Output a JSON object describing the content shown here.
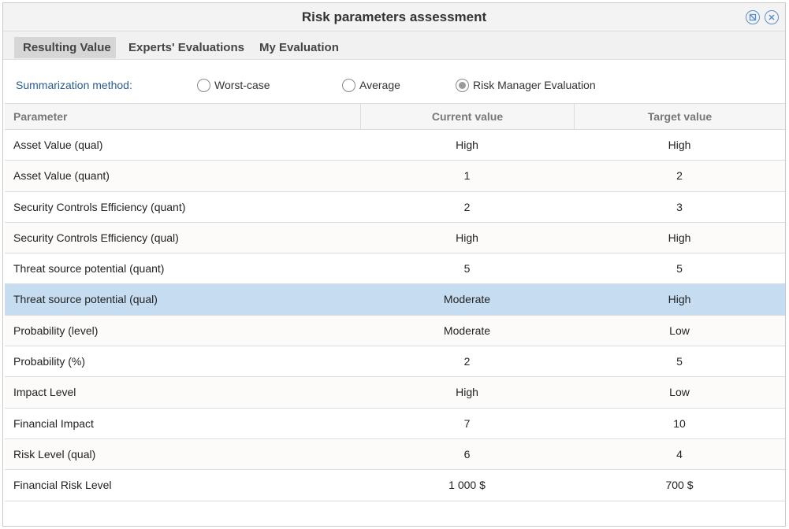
{
  "window": {
    "title": "Risk parameters assessment",
    "accent_color": "#5b8fc9"
  },
  "tabs": [
    {
      "label": "Resulting Value",
      "active": true
    },
    {
      "label": "Experts' Evaluations",
      "active": false
    },
    {
      "label": "My Evaluation",
      "active": false
    }
  ],
  "summarization": {
    "label": "Summarization method:",
    "options": [
      {
        "label": "Worst-case",
        "selected": false
      },
      {
        "label": "Average",
        "selected": false
      },
      {
        "label": "Risk Manager Evaluation",
        "selected": true
      }
    ]
  },
  "table": {
    "headers": [
      "Parameter",
      "Current value",
      "Target value"
    ],
    "selected_row_color": "#c6ddf1",
    "rows": [
      {
        "parameter": "Asset Value (qual)",
        "current": "High",
        "target": "High"
      },
      {
        "parameter": "Asset Value (quant)",
        "current": "1",
        "target": "2"
      },
      {
        "parameter": "Security Controls Efficiency (quant)",
        "current": "2",
        "target": "3"
      },
      {
        "parameter": "Security Controls Efficiency (qual)",
        "current": "High",
        "target": "High"
      },
      {
        "parameter": "Threat source potential (quant)",
        "current": "5",
        "target": "5"
      },
      {
        "parameter": "Threat source potential (qual)",
        "current": "Moderate",
        "target": "High"
      },
      {
        "parameter": "Probability (level)",
        "current": "Moderate",
        "target": "Low"
      },
      {
        "parameter": "Probability (%)",
        "current": "2",
        "target": "5"
      },
      {
        "parameter": "Impact Level",
        "current": "High",
        "target": "Low"
      },
      {
        "parameter": "Financial Impact",
        "current": "7",
        "target": "10"
      },
      {
        "parameter": "Risk Level (qual)",
        "current": "6",
        "target": "4"
      },
      {
        "parameter": "Financial Risk Level",
        "current": "1 000 $",
        "target": "700 $"
      }
    ]
  }
}
